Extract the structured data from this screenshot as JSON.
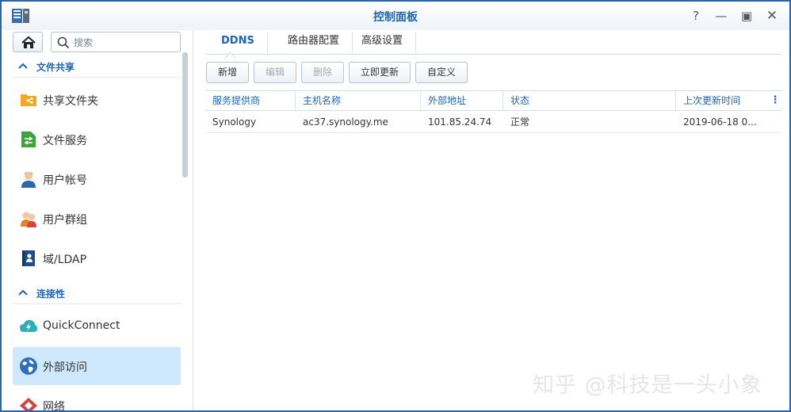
{
  "window": {
    "title": "控制面板",
    "help": "?",
    "minimize": "—",
    "maximize": "▣",
    "close": "✕"
  },
  "search": {
    "placeholder": "搜索"
  },
  "sidebar": {
    "sections": [
      {
        "label": "文件共享",
        "items": [
          {
            "label": "共享文件夹",
            "icon": "shared-folder-icon",
            "color": "#f5a623"
          },
          {
            "label": "文件服务",
            "icon": "file-services-icon",
            "color": "#3aa53a"
          },
          {
            "label": "用户帐号",
            "icon": "user-icon",
            "color": "#2b6aa6"
          },
          {
            "label": "用户群组",
            "icon": "group-icon",
            "color": "#e8822a"
          },
          {
            "label": "域/LDAP",
            "icon": "domain-icon",
            "color": "#1d4e8a"
          }
        ]
      },
      {
        "label": "连接性",
        "items": [
          {
            "label": "QuickConnect",
            "icon": "quickconnect-icon",
            "color": "#2cb0b8"
          },
          {
            "label": "外部访问",
            "icon": "globe-icon",
            "color": "#2d6fb8",
            "active": true
          },
          {
            "label": "网络",
            "icon": "network-icon",
            "color": "#d9413a"
          }
        ]
      }
    ]
  },
  "tabs": [
    "DDNS",
    "路由器配置",
    "高级设置"
  ],
  "active_tab": "DDNS",
  "toolbar": {
    "add": "新增",
    "edit": "编辑",
    "delete": "删除",
    "update_now": "立即更新",
    "customize": "自定义"
  },
  "table": {
    "columns": [
      "服务提供商",
      "主机名称",
      "外部地址",
      "状态",
      "上次更新时间"
    ],
    "rows": [
      {
        "provider": "Synology",
        "hostname": "ac37.synology.me",
        "external": "101.85.24.74",
        "status": "正常",
        "updated": "2019-06-18 0..."
      }
    ],
    "column_menu": "⋮"
  },
  "watermark": "知乎 @科技是一头小象",
  "colors": {
    "accent": "#1e66b4",
    "border": "#2b64a8",
    "active_bg": "#cfe8fb",
    "status_ok": "#3a9a1c"
  }
}
